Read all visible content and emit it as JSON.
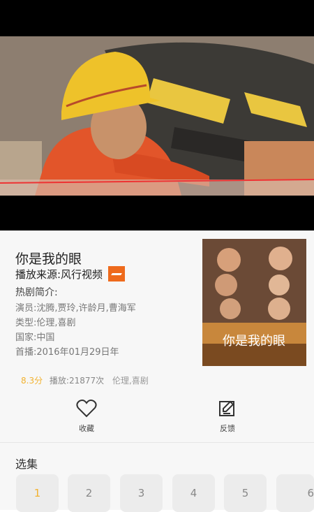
{
  "video": {
    "watermark": ""
  },
  "show": {
    "title": "你是我的眼",
    "source_label": "播放来源:风行视频",
    "synopsis_heading": "热剧简介:",
    "actors": "演员:沈腾,贾玲,许龄月,曹海军",
    "genre": "类型:伦理,喜剧",
    "country": "国家:中国",
    "premiere": "首播:2016年01月29日年",
    "poster_title": "你是我的眼"
  },
  "stats": {
    "score": "8.3分",
    "plays": "播放:21877次",
    "tags": "伦理,喜剧"
  },
  "actions": {
    "favorite": "收藏",
    "feedback": "反馈"
  },
  "episodes": {
    "heading": "选集",
    "items": [
      "1",
      "2",
      "3",
      "4",
      "5",
      "6"
    ],
    "selected": "1"
  },
  "colors": {
    "accent": "#f2b230",
    "source_brand": "#ee6a1c"
  }
}
